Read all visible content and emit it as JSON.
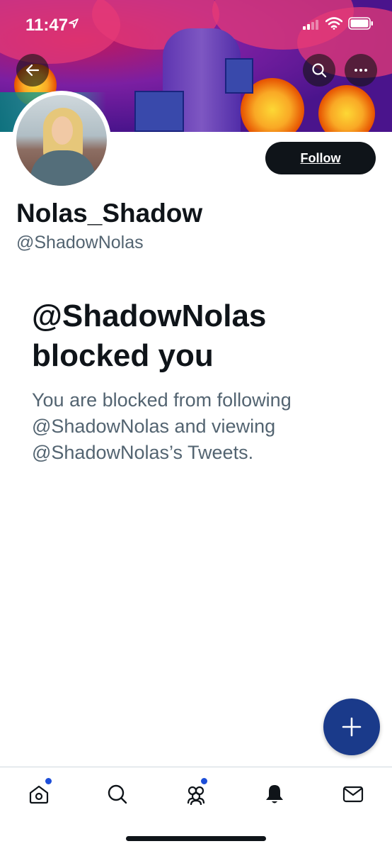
{
  "status_bar": {
    "time": "11:47"
  },
  "profile": {
    "display_name": "Nolas_Shadow",
    "handle": "@ShadowNolas",
    "follow_label": "Follow"
  },
  "blocked_notice": {
    "title": "@ShadowNolas blocked you",
    "body": "You are blocked from following @ShadowNolas and viewing @ShadowNolas’s Tweets."
  },
  "icons": {
    "back": "arrow-left-icon",
    "search": "search-icon",
    "more": "more-dots-icon",
    "compose": "plus-icon",
    "nav_home": "home-icon",
    "nav_search": "search-icon",
    "nav_communities": "communities-icon",
    "nav_notifications": "bell-icon",
    "nav_messages": "mail-icon"
  },
  "colors": {
    "primary_text": "#0f1419",
    "secondary_text": "#536471",
    "fab": "#1a3a8a",
    "notification_dot": "#1d4ed8"
  }
}
